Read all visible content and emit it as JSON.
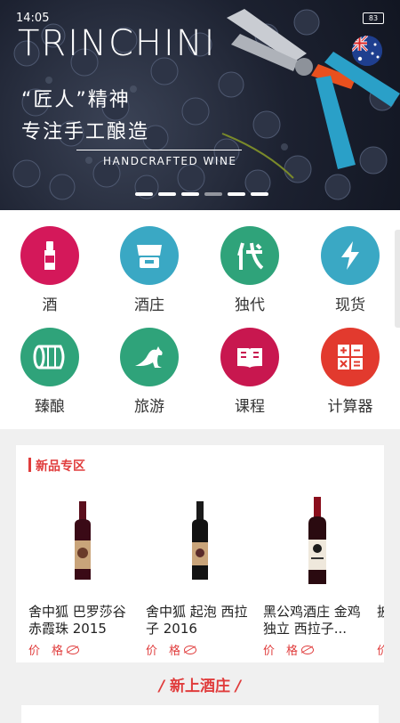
{
  "status_bar": {
    "time": "14:05",
    "battery": "83"
  },
  "banner": {
    "brand": "TRINCHINI",
    "tagline_1": "“匠人”精神",
    "tagline_2": "专注手工酿造",
    "tagline_3": "HANDCRAFTED WINE",
    "slide_count": 6,
    "active_slide": 4
  },
  "categories": [
    {
      "label": "酒",
      "icon": "wine-bottle-icon",
      "color": "#d4185a"
    },
    {
      "label": "酒庄",
      "icon": "winery-store-icon",
      "color": "#3aa8c4"
    },
    {
      "label": "独代",
      "icon": "exclusive-agent-icon",
      "color": "#2fa37a"
    },
    {
      "label": "现货",
      "icon": "lightning-icon",
      "color": "#3aa8c4"
    },
    {
      "label": "臻酿",
      "icon": "barrel-icon",
      "color": "#2fa37a"
    },
    {
      "label": "旅游",
      "icon": "kangaroo-icon",
      "color": "#2fa37a"
    },
    {
      "label": "课程",
      "icon": "book-icon",
      "color": "#c8174f"
    },
    {
      "label": "计算器",
      "icon": "calculator-icon",
      "color": "#e23a2e"
    }
  ],
  "new_products": {
    "title": "新品专区",
    "items": [
      {
        "name": "舍中狐 巴罗莎谷 赤霞珠 2015",
        "price_label": "价　格"
      },
      {
        "name": "舍中狐 起泡 西拉子 2016",
        "price_label": "价　格"
      },
      {
        "name": "黑公鸡酒庄 金鸡独立 西拉子...",
        "price_label": "价　格"
      },
      {
        "name": "披",
        "price_label": "价"
      }
    ]
  },
  "new_wineries": {
    "title": "新上酒庄"
  }
}
